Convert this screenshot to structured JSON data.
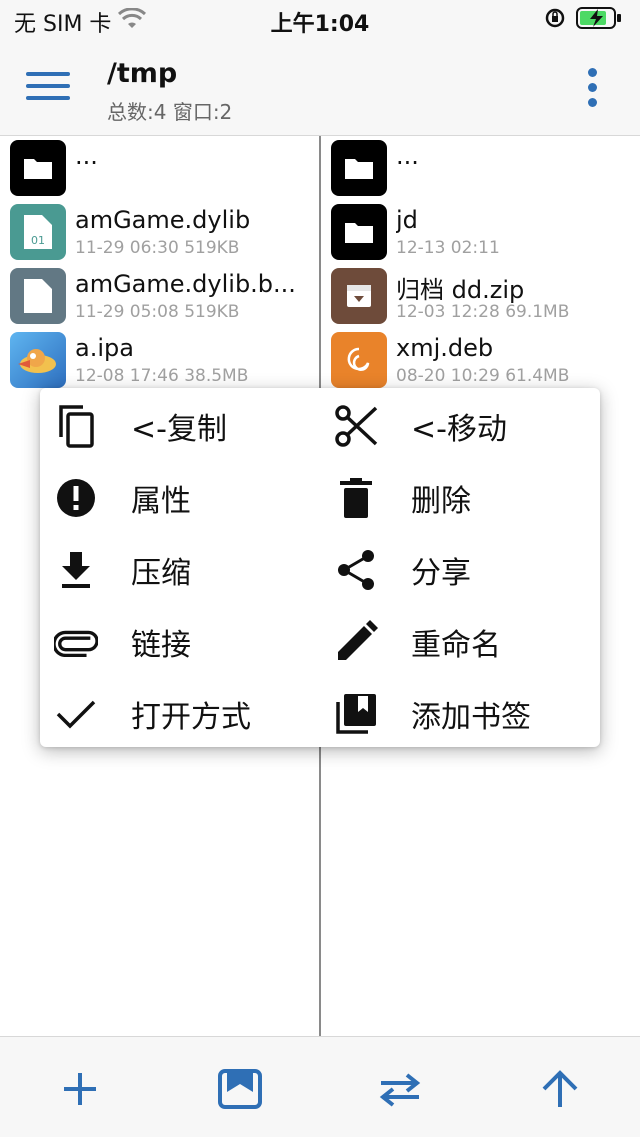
{
  "status_bar": {
    "carrier": "无 SIM 卡",
    "time": "上午1:04"
  },
  "nav": {
    "title": "/tmp",
    "subtitle": "总数:4 窗口:2",
    "accent_color": "#2f6fb5"
  },
  "left_pane": {
    "files": [
      {
        "name": "...",
        "meta": "",
        "icon": "folder-icon"
      },
      {
        "name": "amGame.dylib",
        "meta": "11-29 06:30 519KB",
        "icon": "binary-file-icon"
      },
      {
        "name": "amGame.dylib.b...",
        "meta": "11-29 05:08 519KB",
        "icon": "file-icon"
      },
      {
        "name": "a.ipa",
        "meta": "12-08 17:46 38.5MB",
        "icon": "app-icon"
      }
    ]
  },
  "right_pane": {
    "files": [
      {
        "name": "...",
        "meta": "",
        "icon": "folder-icon"
      },
      {
        "name": "jd",
        "meta": "12-13 02:11",
        "icon": "folder-icon"
      },
      {
        "name": "归档 dd.zip",
        "meta": "12-03 12:28 69.1MB",
        "icon": "archive-icon"
      },
      {
        "name": "xmj.deb",
        "meta": "08-20 10:29 61.4MB",
        "icon": "debian-icon"
      }
    ]
  },
  "context_menu": {
    "items": [
      {
        "label": "<-复制",
        "icon": "copy-icon"
      },
      {
        "label": "<-移动",
        "icon": "scissors-icon"
      },
      {
        "label": "属性",
        "icon": "info-icon"
      },
      {
        "label": "删除",
        "icon": "trash-icon"
      },
      {
        "label": "压缩",
        "icon": "download-icon"
      },
      {
        "label": "分享",
        "icon": "share-icon"
      },
      {
        "label": "链接",
        "icon": "link-icon"
      },
      {
        "label": "重命名",
        "icon": "pencil-icon"
      },
      {
        "label": "打开方式",
        "icon": "check-icon"
      },
      {
        "label": "添加书签",
        "icon": "bookmarks-icon"
      }
    ]
  },
  "toolbar": {
    "icons": [
      "plus-icon",
      "bookmark-icon",
      "swap-icon",
      "arrow-up-icon"
    ]
  }
}
